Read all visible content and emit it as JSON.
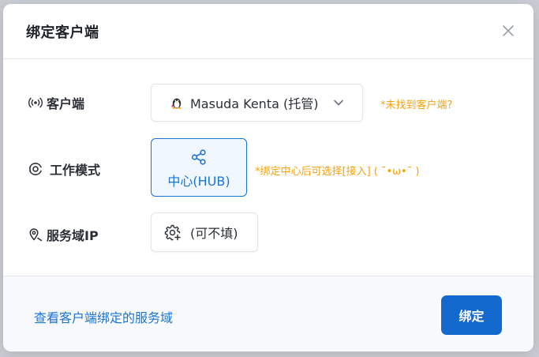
{
  "dialog": {
    "title": "绑定客户端",
    "close_icon": "close-icon"
  },
  "fields": {
    "client": {
      "label": "客户端",
      "icon": "radio-signal-icon",
      "selected_value": "Masuda Kenta (托管)",
      "option_icon": "penguin-icon",
      "hint": "*未找到客户端?"
    },
    "work_mode": {
      "label": "工作模式",
      "icon": "eye-target-icon",
      "selected_mode": "中心(HUB)",
      "mode_icon": "share-nodes-icon",
      "hint": "*绑定中心后可选择[接入] ( ˉ•ω•ˉ )"
    },
    "service_domain": {
      "label": "服务域IP",
      "icon": "location-pin-icon",
      "button_label": "(可不填)",
      "button_icon": "gear-plus-icon"
    }
  },
  "footer": {
    "link": "查看客户端绑定的服务域",
    "confirm": "绑定"
  },
  "colors": {
    "primary": "#1469cf",
    "hint": "#f5a20a",
    "selected_bg": "#f1f7fe"
  }
}
